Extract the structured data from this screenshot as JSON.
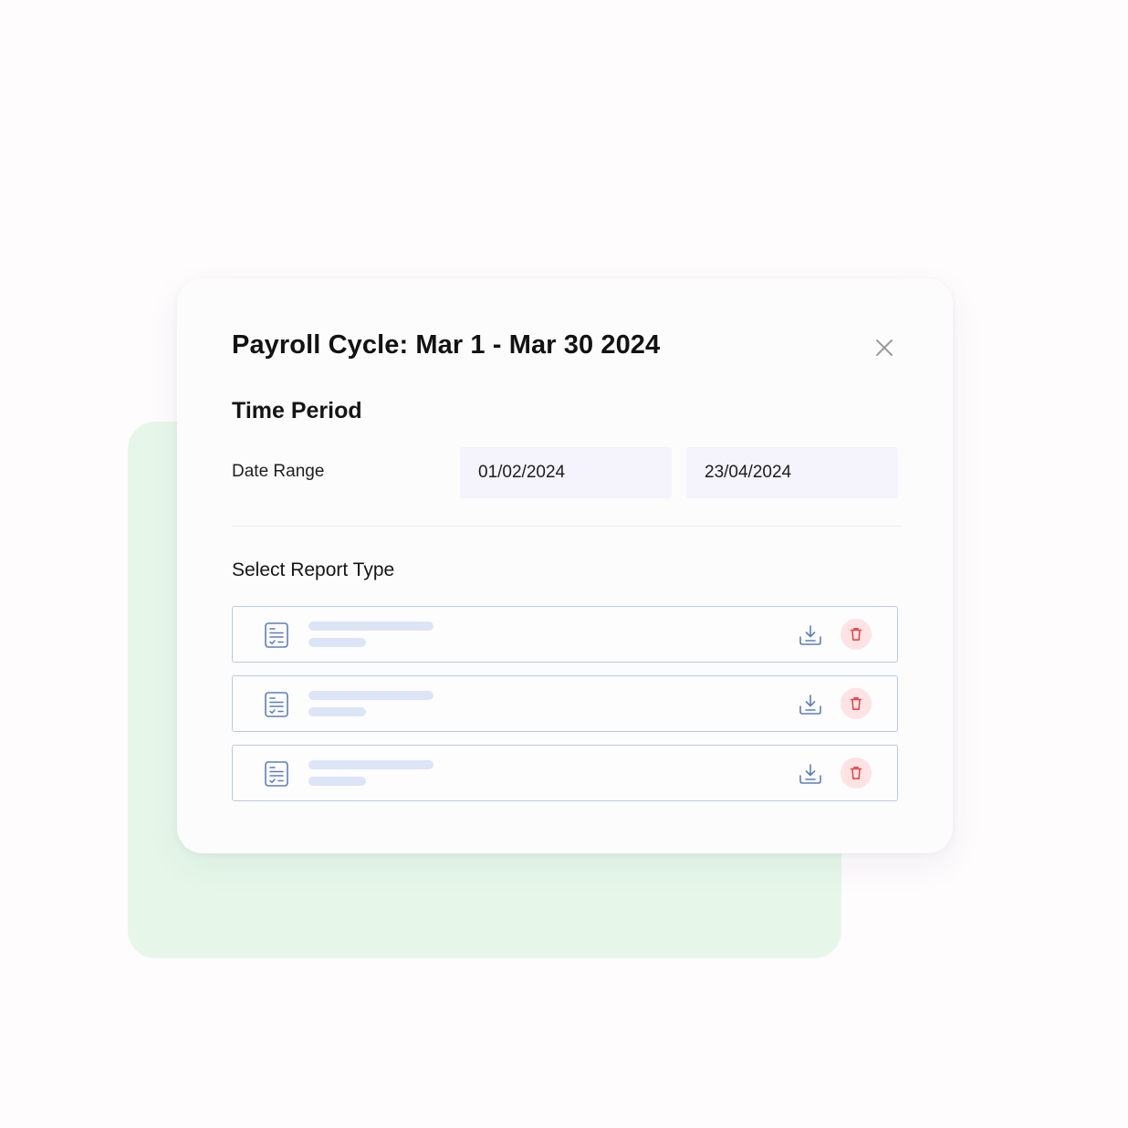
{
  "modal": {
    "title": "Payroll Cycle: Mar 1 - Mar 30 2024",
    "close_icon": "close-icon"
  },
  "time_period": {
    "heading": "Time Period",
    "date_range_label": "Date Range",
    "start_date": "01/02/2024",
    "end_date": "23/04/2024"
  },
  "report_type": {
    "heading": "Select Report Type",
    "rows": [
      {
        "icon": "document-icon",
        "actions": [
          "download-icon",
          "trash-icon"
        ]
      },
      {
        "icon": "document-icon",
        "actions": [
          "download-icon",
          "trash-icon"
        ]
      },
      {
        "icon": "document-icon",
        "actions": [
          "download-icon",
          "trash-icon"
        ]
      }
    ]
  },
  "colors": {
    "backdrop": "#e6f7ea",
    "modal_bg": "#fdfcfd",
    "input_bg": "#f5f3fb",
    "row_border": "#b9c9e3",
    "placeholder_line": "#dce5f6",
    "icon_blue": "#5b7fb8",
    "delete_bg": "#fde3e4",
    "delete_icon": "#e5484d"
  }
}
